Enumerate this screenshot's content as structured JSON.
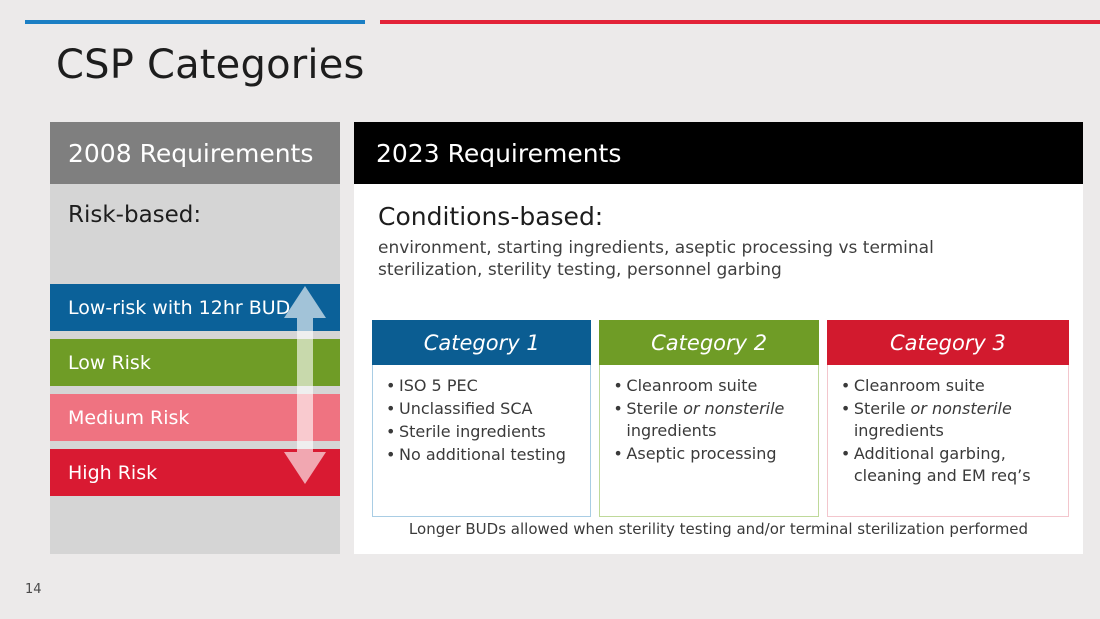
{
  "slide": {
    "title": "CSP Categories",
    "page_number": "14",
    "accent_blue": "#1b7fc4",
    "accent_red": "#e32338"
  },
  "left_panel": {
    "header": "2008 Requirements",
    "subtitle": "Risk-based:",
    "header_bg": "#7f7f7f",
    "body_bg": "#d5d5d5",
    "arrow_icon": "double-headed-vertical-arrow",
    "risk_levels": [
      {
        "label": "Low-risk with 12hr BUD",
        "color": "#0b6199"
      },
      {
        "label": "Low Risk",
        "color": "#6f9c26"
      },
      {
        "label": "Medium Risk",
        "color": "#ef7381"
      },
      {
        "label": "High Risk",
        "color": "#d91a32"
      }
    ]
  },
  "right_panel": {
    "header": "2023 Requirements",
    "header_bg": "#000000",
    "subtitle": "Conditions-based:",
    "description": "environment, starting ingredients, aseptic processing vs terminal sterilization, sterility testing, personnel garbing",
    "footnote": "Longer BUDs allowed when sterility testing and/or terminal sterilization performed",
    "categories": [
      {
        "title": "Category 1",
        "color": "#0b5d92",
        "border": "#a9cde4",
        "bullets": [
          {
            "text": "ISO 5 PEC"
          },
          {
            "text": "Unclassified SCA"
          },
          {
            "text": "Sterile ingredients"
          },
          {
            "text": "No additional testing"
          }
        ]
      },
      {
        "title": "Category 2",
        "color": "#6f9c26",
        "border": "#bfd99a",
        "bullets": [
          {
            "text": "Cleanroom suite"
          },
          {
            "pre": "Sterile ",
            "em": "or nonsterile",
            "post": " ingredients"
          },
          {
            "text": "Aseptic processing"
          }
        ]
      },
      {
        "title": "Category 3",
        "color": "#d21a2e",
        "border": "#f3c6cd",
        "bullets": [
          {
            "text": "Cleanroom suite"
          },
          {
            "pre": "Sterile ",
            "em": "or nonsterile",
            "post": " ingredients"
          },
          {
            "text": "Additional garbing, cleaning and EM req’s"
          }
        ]
      }
    ]
  }
}
